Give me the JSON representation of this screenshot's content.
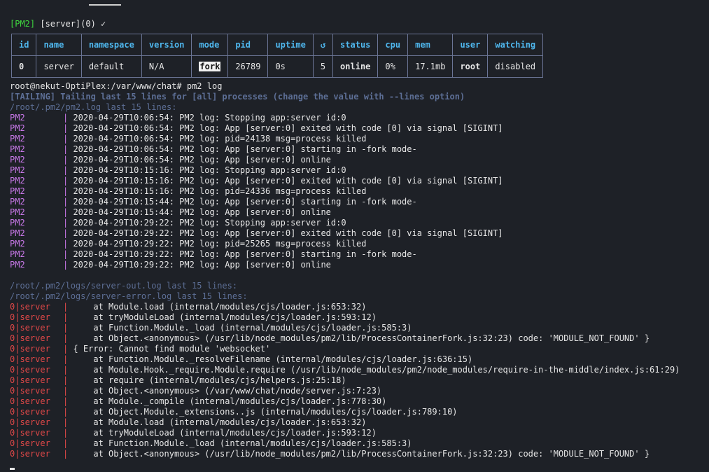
{
  "prompt_top": {
    "tag": "[PM2]",
    "rest": " [server](0) ✓"
  },
  "table": {
    "headers": [
      "id",
      "name",
      "namespace",
      "version",
      "mode",
      "pid",
      "uptime",
      "↺",
      "status",
      "cpu",
      "mem",
      "user",
      "watching"
    ],
    "row": {
      "id": "0",
      "name": "server",
      "namespace": "default",
      "version": "N/A",
      "mode": "fork",
      "pid": "26789",
      "uptime": "0s",
      "restarts": "5",
      "status": "online",
      "cpu": "0%",
      "mem": "17.1mb",
      "user": "root",
      "watching": "disabled"
    }
  },
  "command": "root@nekut-OptiPlex:/var/www/chat# pm2 log",
  "tailing": "[TAILING] Tailing last 15 lines for [all] processes (change the value with --lines option)",
  "pm2_header": "/root/.pm2/pm2.log last 15 lines:",
  "pm2_lines": [
    "2020-04-29T10:06:54: PM2 log: Stopping app:server id:0",
    "2020-04-29T10:06:54: PM2 log: App [server:0] exited with code [0] via signal [SIGINT]",
    "2020-04-29T10:06:54: PM2 log: pid=24138 msg=process killed",
    "2020-04-29T10:06:54: PM2 log: App [server:0] starting in -fork mode-",
    "2020-04-29T10:06:54: PM2 log: App [server:0] online",
    "2020-04-29T10:15:16: PM2 log: Stopping app:server id:0",
    "2020-04-29T10:15:16: PM2 log: App [server:0] exited with code [0] via signal [SIGINT]",
    "2020-04-29T10:15:16: PM2 log: pid=24336 msg=process killed",
    "2020-04-29T10:15:44: PM2 log: App [server:0] starting in -fork mode-",
    "2020-04-29T10:15:44: PM2 log: App [server:0] online",
    "2020-04-29T10:29:22: PM2 log: Stopping app:server id:0",
    "2020-04-29T10:29:22: PM2 log: App [server:0] exited with code [0] via signal [SIGINT]",
    "2020-04-29T10:29:22: PM2 log: pid=25265 msg=process killed",
    "2020-04-29T10:29:22: PM2 log: App [server:0] starting in -fork mode-",
    "2020-04-29T10:29:22: PM2 log: App [server:0] online"
  ],
  "pm2_label": "PM2",
  "out_header": "/root/.pm2/logs/server-out.log last 15 lines:",
  "err_header": "/root/.pm2/logs/server-error.log last 15 lines:",
  "err_label": "0|server",
  "err_lines": [
    "    at Module.load (internal/modules/cjs/loader.js:653:32)",
    "    at tryModuleLoad (internal/modules/cjs/loader.js:593:12)",
    "    at Function.Module._load (internal/modules/cjs/loader.js:585:3)",
    "    at Object.<anonymous> (/usr/lib/node_modules/pm2/lib/ProcessContainerFork.js:32:23) code: 'MODULE_NOT_FOUND' }",
    "{ Error: Cannot find module 'websocket'",
    "    at Function.Module._resolveFilename (internal/modules/cjs/loader.js:636:15)",
    "    at Module.Hook._require.Module.require (/usr/lib/node_modules/pm2/node_modules/require-in-the-middle/index.js:61:29)",
    "    at require (internal/modules/cjs/helpers.js:25:18)",
    "    at Object.<anonymous> (/var/www/chat/node/server.js:7:23)",
    "    at Module._compile (internal/modules/cjs/loader.js:778:30)",
    "    at Object.Module._extensions..js (internal/modules/cjs/loader.js:789:10)",
    "    at Module.load (internal/modules/cjs/loader.js:653:32)",
    "    at tryModuleLoad (internal/modules/cjs/loader.js:593:12)",
    "    at Function.Module._load (internal/modules/cjs/loader.js:585:3)",
    "    at Object.<anonymous> (/usr/lib/node_modules/pm2/lib/ProcessContainerFork.js:32:23) code: 'MODULE_NOT_FOUND' }"
  ],
  "colors": {
    "background": "#1e2127",
    "pm2_tag": "#3fd83f",
    "header": "#4fb7ee",
    "purple": "#c878e8",
    "red": "#e04848",
    "grey": "#5d6f96"
  }
}
